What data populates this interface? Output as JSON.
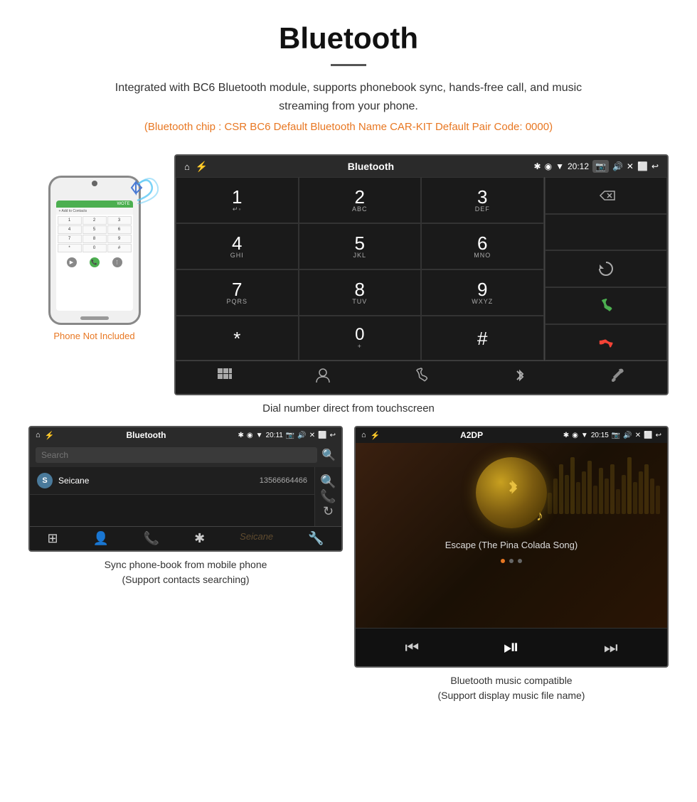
{
  "header": {
    "title": "Bluetooth",
    "description": "Integrated with BC6 Bluetooth module, supports phonebook sync, hands-free call, and music streaming from your phone.",
    "specs": "(Bluetooth chip : CSR BC6    Default Bluetooth Name CAR-KIT    Default Pair Code: 0000)"
  },
  "phone": {
    "label": "Phone Not Included",
    "screen_header": "WOTE",
    "add_contacts": "+ Add to Contacts",
    "keys": [
      "1",
      "2",
      "3",
      "4",
      "5",
      "6",
      "7",
      "8",
      "9",
      "*",
      "0",
      "#"
    ]
  },
  "dial_screen": {
    "title": "Bluetooth",
    "time": "20:12",
    "keys": [
      {
        "num": "1",
        "sub": "↵◦"
      },
      {
        "num": "2",
        "sub": "ABC"
      },
      {
        "num": "3",
        "sub": "DEF"
      },
      {
        "num": "4",
        "sub": "GHI"
      },
      {
        "num": "5",
        "sub": "JKL"
      },
      {
        "num": "6",
        "sub": "MNO"
      },
      {
        "num": "7",
        "sub": "PQRS"
      },
      {
        "num": "8",
        "sub": "TUV"
      },
      {
        "num": "9",
        "sub": "WXYZ"
      },
      {
        "num": "*",
        "sub": ""
      },
      {
        "num": "0",
        "sub": "+"
      },
      {
        "num": "#",
        "sub": ""
      }
    ]
  },
  "dial_caption": "Dial number direct from touchscreen",
  "phonebook_screen": {
    "title": "Bluetooth",
    "time": "20:11",
    "search_placeholder": "Search",
    "contacts": [
      {
        "initial": "S",
        "name": "Seicane",
        "phone": "13566664466"
      }
    ]
  },
  "phonebook_caption_line1": "Sync phone-book from mobile phone",
  "phonebook_caption_line2": "(Support contacts searching)",
  "music_screen": {
    "title": "A2DP",
    "time": "20:15",
    "song": "Escape (The Pina Colada Song)"
  },
  "music_caption_line1": "Bluetooth music compatible",
  "music_caption_line2": "(Support display music file name)",
  "eq_bars": [
    30,
    50,
    70,
    55,
    80,
    45,
    60,
    75,
    40,
    65,
    50,
    70,
    35,
    55,
    80,
    45,
    60,
    70,
    50,
    40
  ]
}
